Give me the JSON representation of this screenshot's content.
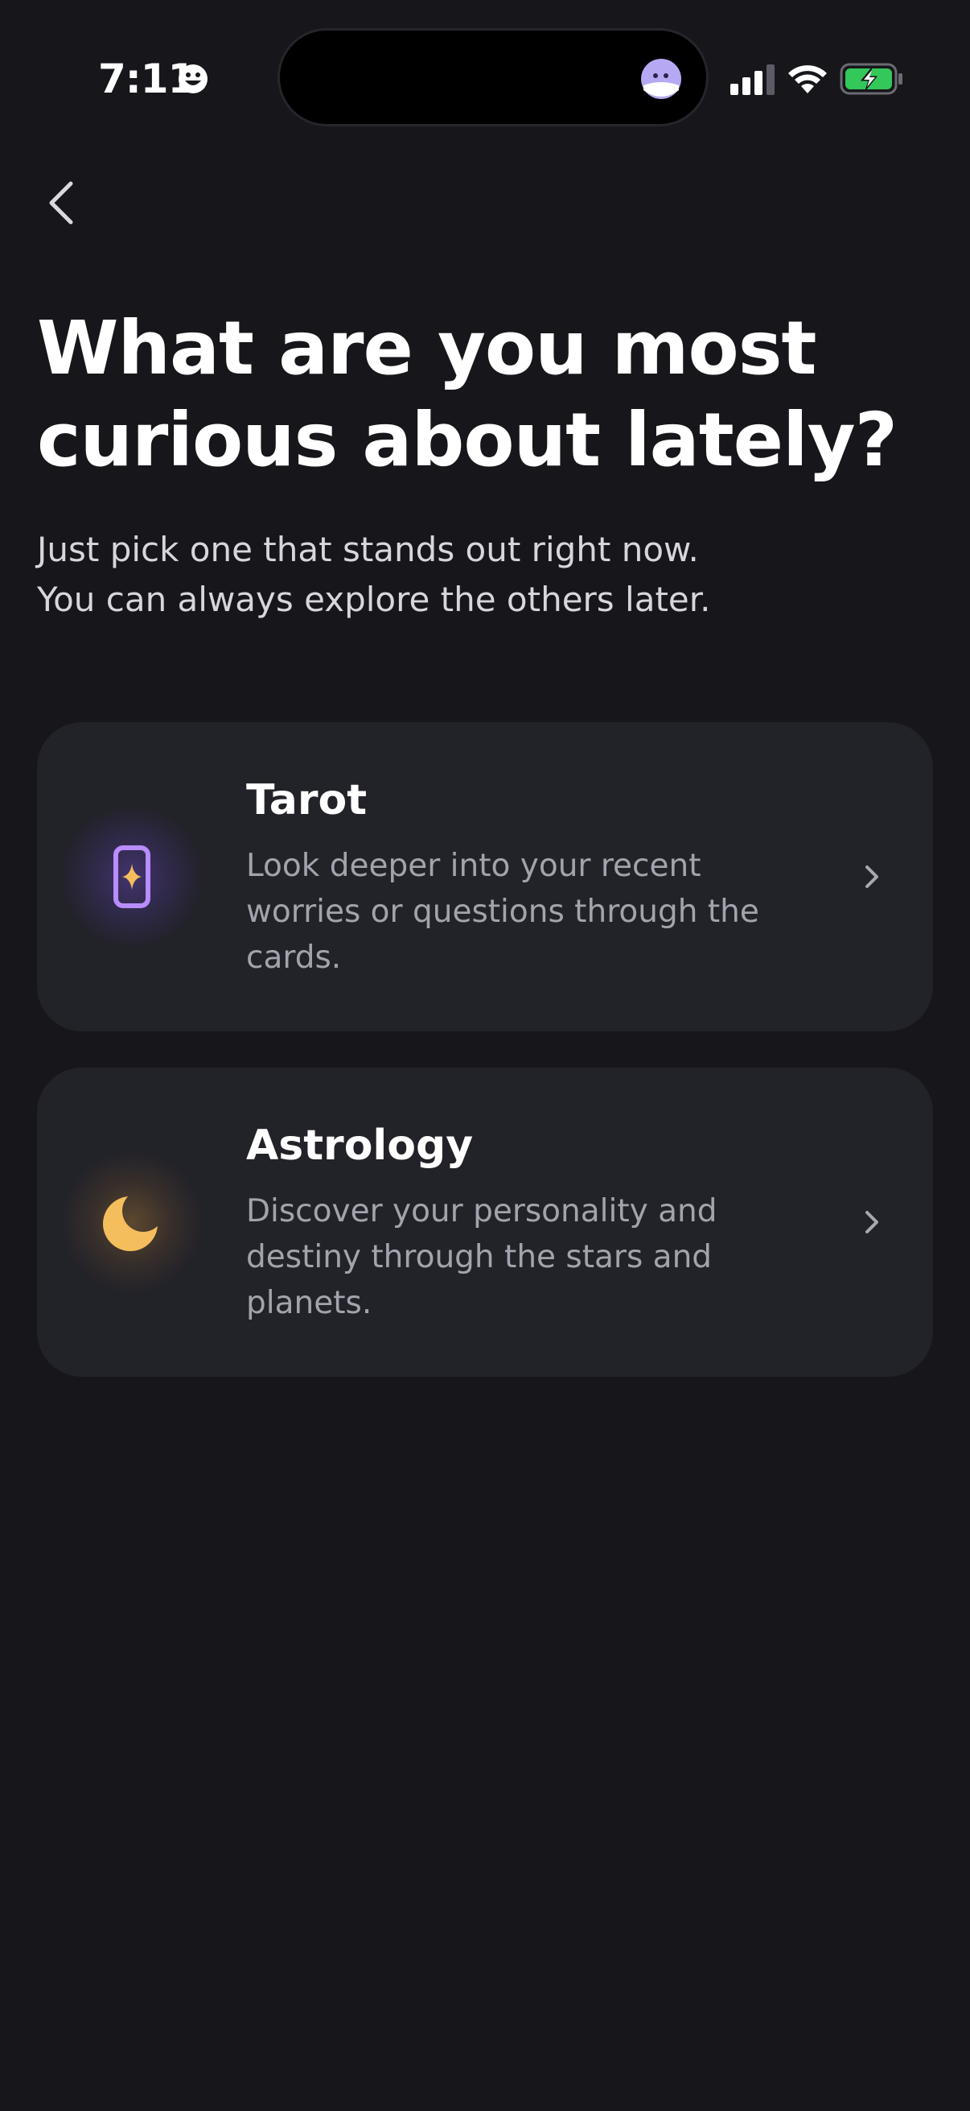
{
  "status_bar": {
    "time": "7:11"
  },
  "header": {
    "title": "What are you most curious about lately?",
    "subtitle_line1": "Just pick one that stands out right now.",
    "subtitle_line2": "You can always explore the others later."
  },
  "options": [
    {
      "title": "Tarot",
      "description": "Look deeper into your recent worries or questions through the cards.",
      "icon": "tarot-card-icon",
      "accent": "#b98cff"
    },
    {
      "title": "Astrology",
      "description": "Discover your personality and destiny through the stars and planets.",
      "icon": "moon-icon",
      "accent": "#f4be5c"
    }
  ],
  "colors": {
    "background": "#16161b",
    "card": "#222229",
    "text_primary": "#ffffff",
    "text_secondary": "#a3a3ad"
  }
}
